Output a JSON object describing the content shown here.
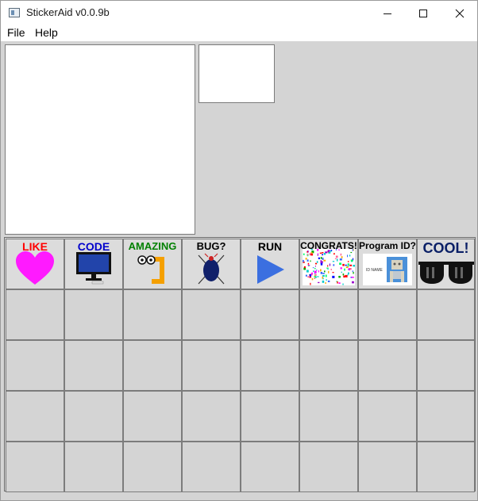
{
  "window": {
    "title": "StickerAid v0.0.9b"
  },
  "menu": {
    "items": [
      "File",
      "Help"
    ]
  },
  "stickers": [
    {
      "label": "LIKE",
      "color": "#ff0000",
      "icon": "heart-icon"
    },
    {
      "label": "CODE",
      "color": "#0000cc",
      "icon": "monitor-icon"
    },
    {
      "label": "AMAZING",
      "color": "#008000",
      "icon": "googly-eyes-icon"
    },
    {
      "label": "BUG?",
      "color": "#000000",
      "icon": "bug-icon"
    },
    {
      "label": "RUN",
      "color": "#000000",
      "icon": "play-triangle-icon"
    },
    {
      "label": "CONGRATS!",
      "color": "#000000",
      "icon": "confetti-icon"
    },
    {
      "label": "Program ID?",
      "color": "#000000",
      "icon": "id-card-icon"
    },
    {
      "label": "COOL!",
      "color": "#0a1f66",
      "icon": "sunglasses-icon"
    }
  ],
  "grid": {
    "columns": 8,
    "rows": 5
  }
}
